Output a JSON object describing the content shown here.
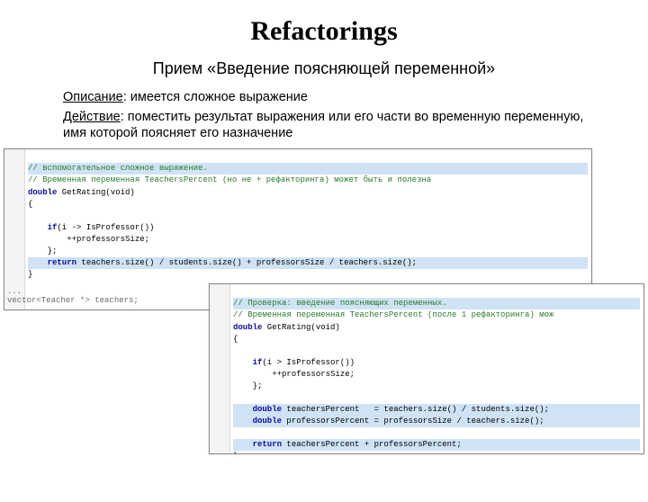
{
  "title": "Refactorings",
  "subtitle": "Прием «Введение поясняющей переменной»",
  "desc1_label": "Описание",
  "desc1_text": ": имеется сложное выражение",
  "desc2_label": "Действие",
  "desc2_text": ": поместить результат выражения или его части во временную переменную, имя которой поясняет его назначение",
  "code1": {
    "c1": "// вспомогательное сложное выражение.",
    "c2": "// Временная переменная TeachersPercent (но не + рефакторинга) может быть и полезна",
    "l3a": "double",
    "l3b": " GetRating(void)",
    "l4": "{",
    "l5a": "    if",
    "l5b": "(i -> IsProfessor())",
    "l6": "        ++professorsSize;",
    "l7": "    };",
    "l8a": "    return",
    "l8b": " teachers.size() / students.size() + professorsSize / teachers.size();",
    "l9": "}"
  },
  "note": {
    "a": "...",
    "b": "vector<Teacher *> teachers;"
  },
  "code2": {
    "c1": "// Проверка: введение поясняющих переменных.",
    "c2": "// Временная переменная TeachersPercent (после 1 рефакторинга) мож",
    "l3a": "double",
    "l3b": " GetRating(void)",
    "l4": "{",
    "l5a": "    if",
    "l5b": "(i > IsProfessor())",
    "l6": "        ++professorsSize;",
    "l7": "    };",
    "l8a": "    double",
    "l8b": " teachersPercent   = teachers.size() / students.size();",
    "l9a": "    double",
    "l9b": " professorsPercent = professorsSize / teachers.size();",
    "l10a": "    return",
    "l10b": " teachersPercent + professorsPercent;",
    "l11": "}"
  }
}
